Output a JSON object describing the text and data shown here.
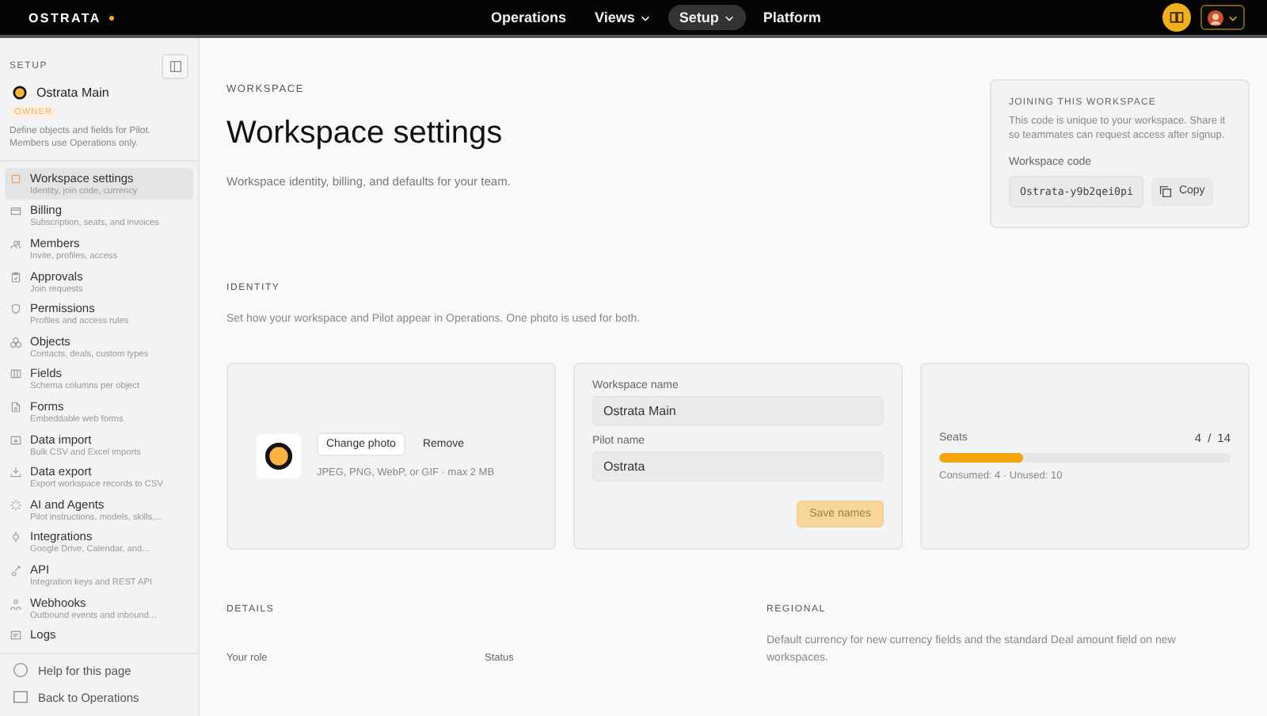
{
  "topbar": {
    "logo": "OSTRATA",
    "nav": [
      {
        "label": "Operations",
        "selected": false,
        "dropdown": false
      },
      {
        "label": "Views",
        "selected": false,
        "dropdown": true
      },
      {
        "label": "Setup",
        "selected": true,
        "dropdown": true
      },
      {
        "label": "Platform",
        "selected": false,
        "dropdown": false
      }
    ]
  },
  "sidebar": {
    "heading": "SETUP",
    "workspace": "Ostrata Main",
    "role": "OWNER",
    "note": "Define objects and fields for Pilot. Members use Operations only.",
    "items": [
      {
        "title": "Workspace settings",
        "subtitle": "Identity, join code, currency",
        "selected": true
      },
      {
        "title": "Billing",
        "subtitle": "Subscription, seats, and invoices",
        "selected": false
      },
      {
        "title": "Members",
        "subtitle": "Invite, profiles, access",
        "selected": false
      },
      {
        "title": "Approvals",
        "subtitle": "Join requests",
        "selected": false
      },
      {
        "title": "Permissions",
        "subtitle": "Profiles and access rules",
        "selected": false
      },
      {
        "title": "Objects",
        "subtitle": "Contacts, deals, custom types",
        "selected": false
      },
      {
        "title": "Fields",
        "subtitle": "Schema columns per object",
        "selected": false
      },
      {
        "title": "Forms",
        "subtitle": "Embeddable web forms",
        "selected": false
      },
      {
        "title": "Data import",
        "subtitle": "Bulk CSV and Excel imports",
        "selected": false
      },
      {
        "title": "Data export",
        "subtitle": "Export workspace records to CSV",
        "selected": false
      },
      {
        "title": "AI and Agents",
        "subtitle": "Pilot instructions, models, skills,...",
        "selected": false
      },
      {
        "title": "Integrations",
        "subtitle": "Google Drive, Calendar, and...",
        "selected": false
      },
      {
        "title": "API",
        "subtitle": "Integration keys and REST API",
        "selected": false
      },
      {
        "title": "Webhooks",
        "subtitle": "Outbound events and inbound...",
        "selected": false
      },
      {
        "title": "Logs",
        "selected": false
      }
    ],
    "footer": [
      "Help for this page",
      "Back to Operations"
    ]
  },
  "page": {
    "eyebrow": "WORKSPACE",
    "title": "Workspace settings",
    "subtitle": "Workspace identity, billing, and defaults for your team.",
    "join_card": {
      "heading": "JOINING THIS WORKSPACE",
      "text": "This code is unique to your workspace. Share it so teammates can request access after signup.",
      "code_label": "Workspace code",
      "code": "Ostrata-y9b2qei0pi",
      "copy": "Copy"
    },
    "identity": {
      "heading": "IDENTITY",
      "text": "Set how your workspace and Pilot appear in Operations. One photo is used for both.",
      "photo": {
        "change": "Change photo",
        "remove": "Remove",
        "hint": "JPEG, PNG, WebP, or GIF · max 2 MB"
      },
      "names": {
        "workspace_label": "Workspace name",
        "workspace_value": "Ostrata Main",
        "pilot_label": "Pilot name",
        "pilot_value": "Ostrata",
        "save": "Save names",
        "save_disabled": true
      },
      "seats": {
        "label": "Seats",
        "used": "4",
        "slash": "/",
        "total": "14",
        "level": 0.286,
        "summary": "Consumed: 4 · Unused: 10"
      }
    },
    "details": {
      "heading": "DETAILS",
      "columns": [
        "Your role",
        "Status"
      ]
    },
    "regional": {
      "heading": "REGIONAL",
      "text": "Default currency for new currency fields and the standard Deal amount field on new workspaces."
    }
  }
}
